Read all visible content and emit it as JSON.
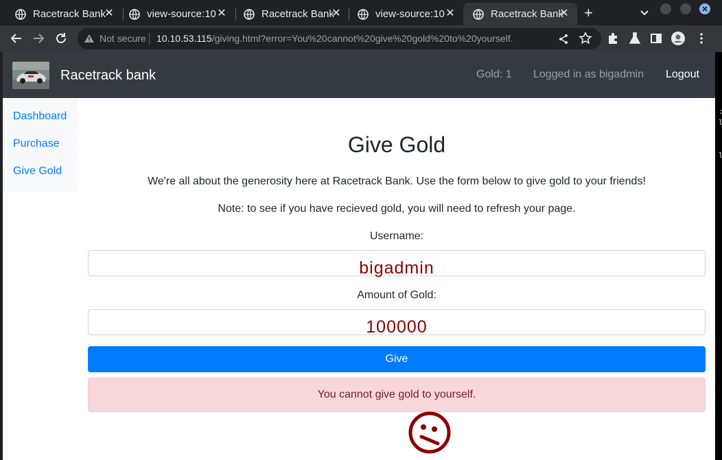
{
  "browser": {
    "tabs": [
      {
        "title": "Racetrack Bank",
        "close": "✕"
      },
      {
        "title": "view-source:10",
        "close": "✕"
      },
      {
        "title": "Racetrack Bank",
        "close": "✕"
      },
      {
        "title": "view-source:10",
        "close": "✕"
      },
      {
        "title": "Racetrack Bank",
        "close": "✕",
        "active": true
      }
    ],
    "new_tab": "+",
    "not_secure": "Not secure",
    "url_host": "10.10.53.115",
    "url_path": "/giving.html?error=You%20cannot%20give%20gold%20to%20yourself."
  },
  "navbar": {
    "brand": "Racetrack bank",
    "gold": "Gold: 1",
    "user": "Logged in as bigadmin",
    "logout": "Logout"
  },
  "sidebar": {
    "items": [
      {
        "label": "Dashboard"
      },
      {
        "label": "Purchase"
      },
      {
        "label": "Give Gold"
      }
    ]
  },
  "main": {
    "title": "Give Gold",
    "intro": "We're all about the generosity here at Racetrack Bank. Use the form below to give gold to your friends!",
    "note": "Note: to see if you have recieved gold, you will need to refresh your page.",
    "username_label": "Username:",
    "username_value": "bigadmin",
    "amount_label": "Amount of Gold:",
    "amount_value": "100000",
    "give_button": "Give",
    "error": "You cannot give gold to yourself."
  },
  "colors": {
    "accent": "#007bff",
    "navbar": "#343a40",
    "error_bg": "#f8d7da",
    "error_text": "#721c24",
    "injected_text": "#8b0000"
  },
  "icons": [
    "globe-icon",
    "close-icon",
    "plus-icon",
    "chevron-down-icon",
    "back-arrow-icon",
    "forward-arrow-icon",
    "reload-icon",
    "warning-icon",
    "share-icon",
    "star-icon",
    "extensions-icon",
    "flask-icon",
    "sidepanel-icon",
    "profile-icon",
    "kebab-menu-icon",
    "sad-face-icon"
  ]
}
